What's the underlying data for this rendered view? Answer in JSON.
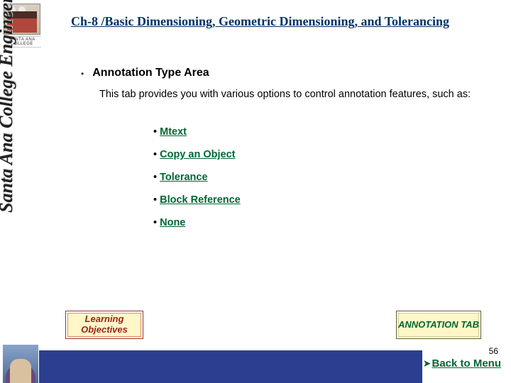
{
  "left": {
    "college_name": "SANTA ANA COLLEGE",
    "vertical": "Santa Ana College Engineering"
  },
  "title": "Ch-8 /Basic Dimensioning, Geometric Dimensioning, and Tolerancing",
  "section": {
    "heading": "Annotation Type Area",
    "description": "This tab provides you with various options to control annotation features, such as:"
  },
  "inner_items": [
    {
      "label": "Mtext"
    },
    {
      "label": "Copy an Object"
    },
    {
      "label": "Tolerance"
    },
    {
      "label": "Block Reference"
    },
    {
      "label": "None"
    }
  ],
  "buttons": {
    "learning": "Learning Objectives",
    "annotation": "ANNOTATION TAB"
  },
  "footer": {
    "page": "56",
    "back_label": "Back to Menu"
  }
}
